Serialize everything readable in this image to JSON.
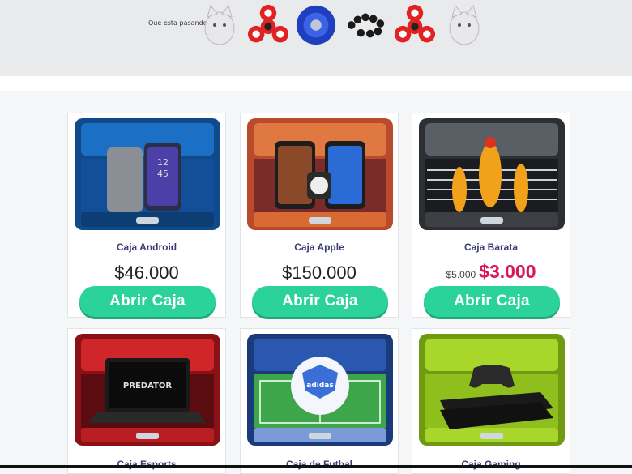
{
  "ticker": {
    "label": "Que esta pasando:",
    "items": [
      "squishy-cat-icon",
      "fidget-spinner-icon",
      "yoyo-icon",
      "bracelet-icon",
      "fidget-spinner-icon",
      "squishy-cat-icon"
    ]
  },
  "colors": {
    "button": "#2bd39a",
    "sale": "#d9165a",
    "name": "#3a3a78"
  },
  "cards": [
    {
      "name": "Caja Android",
      "price": "$46.000",
      "button": "Abrir Caja",
      "theme": "blue"
    },
    {
      "name": "Caja Apple",
      "price": "$150.000",
      "button": "Abrir Caja",
      "theme": "orange"
    },
    {
      "name": "Caja Barata",
      "old_price": "$5.000",
      "sale_price": "$3.000",
      "button": "Abrir Caja",
      "theme": "gray"
    },
    {
      "name": "Caja Esports",
      "theme": "red"
    },
    {
      "name": "Caja de Futbal",
      "theme": "navy"
    },
    {
      "name": "Caja Gaming",
      "theme": "lime"
    }
  ]
}
